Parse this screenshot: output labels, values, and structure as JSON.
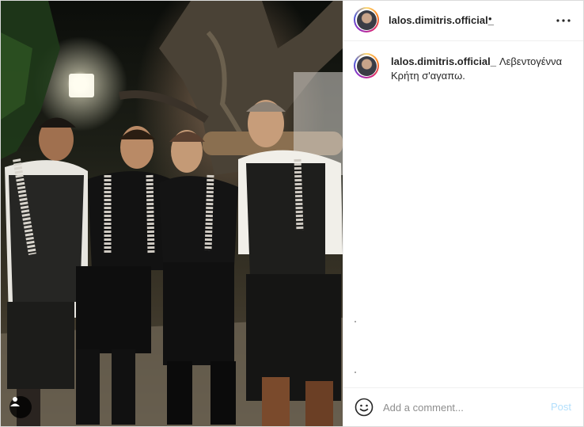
{
  "post": {
    "username": "lalos.dimitris.official_",
    "header_separator": "•",
    "caption": {
      "username": "lalos.dimitris.official_",
      "text": "Λεβεντογέννα Κρήτη σ'αγαπω."
    },
    "photo": {
      "description_icon": "user-tag-icon"
    },
    "comment_box": {
      "placeholder": "Add a comment...",
      "post_label": "Post"
    },
    "icons": {
      "more": "more-options-icon",
      "emoji": "emoji-icon",
      "user_tag": "user-icon"
    },
    "colors": {
      "post_button_disabled": "#b2dffc",
      "border": "#dbdbdb",
      "text": "#262626",
      "muted": "#8e8e8e"
    }
  }
}
